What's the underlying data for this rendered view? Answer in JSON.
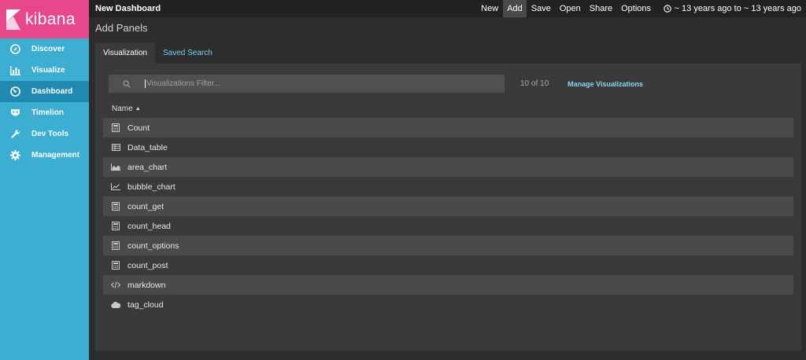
{
  "app": {
    "brand": "kibana"
  },
  "sidebar": {
    "items": [
      {
        "label": "Discover",
        "icon": "compass-icon",
        "active": false
      },
      {
        "label": "Visualize",
        "icon": "bar-chart-icon",
        "active": false
      },
      {
        "label": "Dashboard",
        "icon": "dashboard-gauge-icon",
        "active": true
      },
      {
        "label": "Timelion",
        "icon": "timelion-mask-icon",
        "active": false
      },
      {
        "label": "Dev Tools",
        "icon": "wrench-icon",
        "active": false
      },
      {
        "label": "Management",
        "icon": "gear-icon",
        "active": false
      }
    ]
  },
  "topbar": {
    "title": "New Dashboard",
    "menu": [
      "New",
      "Add",
      "Save",
      "Open",
      "Share",
      "Options"
    ],
    "active_menu": "Add",
    "time_range": "~ 13 years ago to ~ 13 years ago"
  },
  "panel": {
    "title": "Add Panels",
    "tabs": [
      {
        "label": "Visualization",
        "active": true
      },
      {
        "label": "Saved Search",
        "active": false
      }
    ],
    "search": {
      "placeholder": "Visualizations Filter...",
      "value": ""
    },
    "count": "10 of 10",
    "manage_link": "Manage Visualizations",
    "column_header": "Name",
    "rows": [
      {
        "label": "Count",
        "icon": "calculator-icon"
      },
      {
        "label": "Data_table",
        "icon": "table-icon"
      },
      {
        "label": "area_chart",
        "icon": "area-chart-icon"
      },
      {
        "label": "bubble_chart",
        "icon": "line-chart-icon"
      },
      {
        "label": "count_get",
        "icon": "calculator-icon"
      },
      {
        "label": "count_head",
        "icon": "calculator-icon"
      },
      {
        "label": "count_options",
        "icon": "calculator-icon"
      },
      {
        "label": "count_post",
        "icon": "calculator-icon"
      },
      {
        "label": "markdown",
        "icon": "code-icon"
      },
      {
        "label": "tag_cloud",
        "icon": "cloud-icon"
      }
    ]
  },
  "colors": {
    "sidebar": "#3caed2",
    "sidebar_active": "#1f8bb3",
    "logo": "#e8488b",
    "topbar": "#222222",
    "panel": "#3a3a3a",
    "link": "#6dd2ed"
  }
}
